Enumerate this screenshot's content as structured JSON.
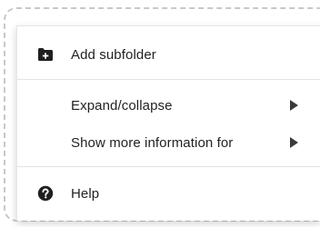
{
  "menu": {
    "items": [
      {
        "label": "Add subfolder",
        "icon": "add-folder-icon"
      },
      {
        "label": "Expand/collapse",
        "icon": "chevron-right-icon"
      },
      {
        "label": "Show more information for",
        "icon": "chevron-right-icon"
      },
      {
        "label": "Help",
        "icon": "help-circle-icon"
      }
    ]
  },
  "colors": {
    "frame_border": "#c8c8c8",
    "divider": "#e3e3e3",
    "text": "#222222",
    "icon": "#1f1f1f"
  }
}
